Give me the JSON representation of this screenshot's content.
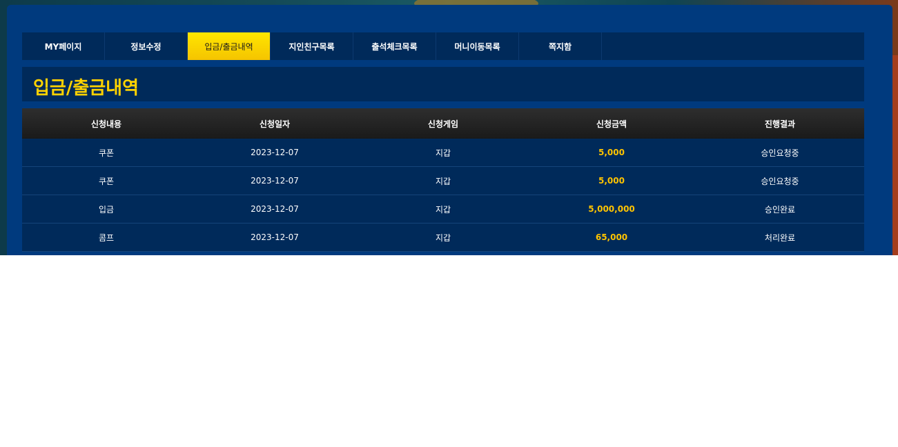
{
  "tabs": [
    {
      "label": "MY페이지",
      "active": false
    },
    {
      "label": "정보수정",
      "active": false
    },
    {
      "label": "입금/출금내역",
      "active": true
    },
    {
      "label": "지인친구목록",
      "active": false
    },
    {
      "label": "출석체크목록",
      "active": false
    },
    {
      "label": "머니이동목록",
      "active": false
    },
    {
      "label": "쪽지함",
      "active": false
    }
  ],
  "section": {
    "title": "입금/출금내역"
  },
  "table": {
    "headers": [
      "신청내용",
      "신청일자",
      "신청게임",
      "신청금액",
      "진행결과"
    ],
    "rows": [
      {
        "type": "쿠폰",
        "date": "2023-12-07",
        "game": "지갑",
        "amount": "5,000",
        "status": "승인요청중"
      },
      {
        "type": "쿠폰",
        "date": "2023-12-07",
        "game": "지갑",
        "amount": "5,000",
        "status": "승인요청중"
      },
      {
        "type": "입금",
        "date": "2023-12-07",
        "game": "지갑",
        "amount": "5,000,000",
        "status": "승인완료"
      },
      {
        "type": "콤프",
        "date": "2023-12-07",
        "game": "지갑",
        "amount": "65,000",
        "status": "처리완료"
      }
    ]
  },
  "colors": {
    "panel": "#003a7e",
    "dark_navy": "#002a5a",
    "accent_yellow": "#ffd200",
    "amount_color": "#ffc400"
  }
}
